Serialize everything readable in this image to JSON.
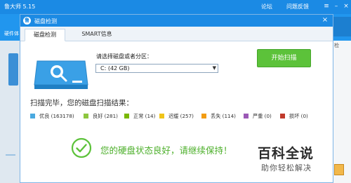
{
  "app": {
    "title": "鲁大师 5.15",
    "title_links": [
      "论坛",
      "问题反馈"
    ],
    "toolbar_label": "硬件体",
    "right_label": "检"
  },
  "dialog": {
    "title": "磁盘检测",
    "tabs": [
      {
        "label": "磁盘检测",
        "active": true
      },
      {
        "label": "SMART信息",
        "active": false
      }
    ],
    "select": {
      "label": "请选择磁盘或者分区：",
      "value": "C:  (42 GB)"
    },
    "start_button": "开始扫描",
    "result_heading": "扫描完毕，您的磁盘扫描结果：",
    "legend": [
      {
        "label": "优良 (163178)",
        "color": "#4aa9e0"
      },
      {
        "label": "良好 (281)",
        "color": "#8dc63f"
      },
      {
        "label": "正常 (14)",
        "color": "#7ab800"
      },
      {
        "label": "迟缓 (257)",
        "color": "#f0c419"
      },
      {
        "label": "丢失 (114)",
        "color": "#f39c12"
      },
      {
        "label": "严重 (0)",
        "color": "#9b59b6"
      },
      {
        "label": "损坏 (0)",
        "color": "#c0392b"
      }
    ],
    "status_text": "您的硬盘状态良好，请继续保持！"
  },
  "watermark": {
    "title": "百科全说",
    "subtitle": "助你轻松解决"
  },
  "colors": {
    "titlebar": "#1b8ae4",
    "accent_green": "#5cc23a",
    "status_green": "#4caf2a"
  }
}
